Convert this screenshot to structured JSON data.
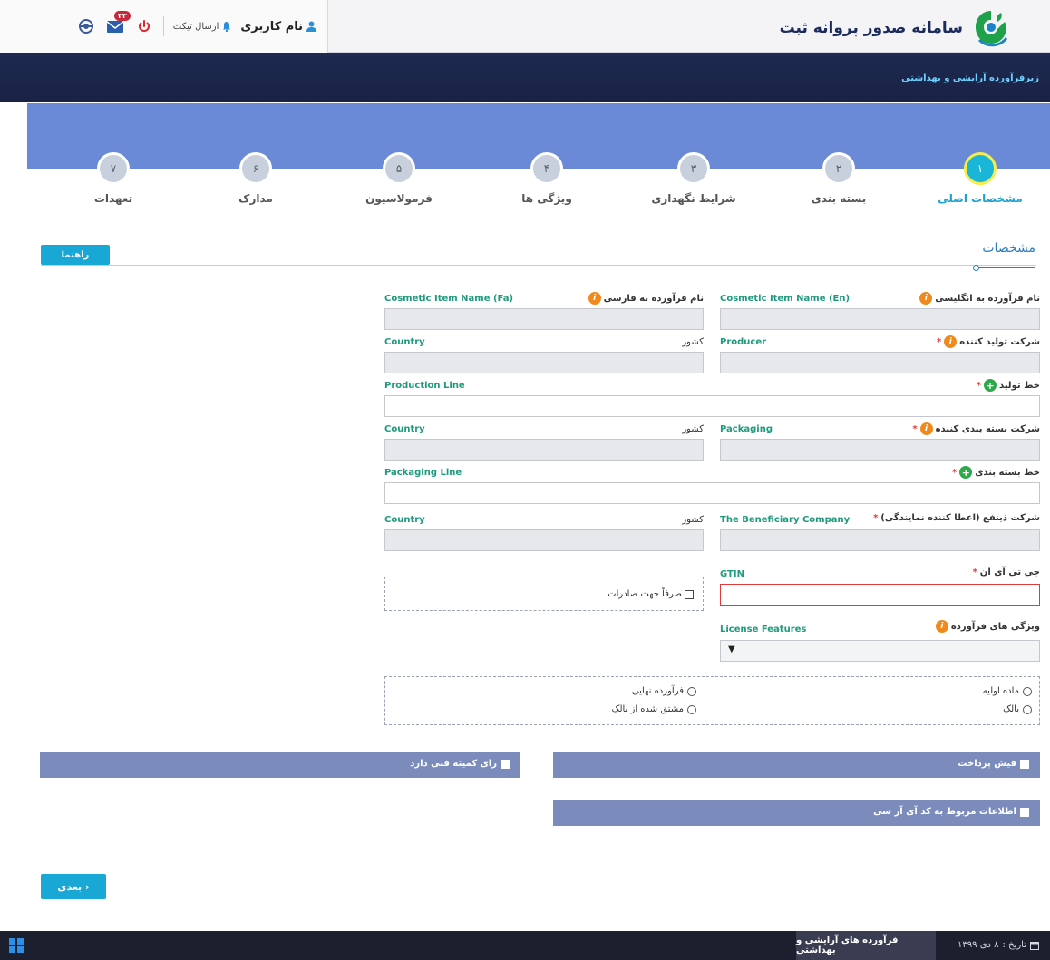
{
  "header": {
    "username": "نام کاربری",
    "send_ticket": "ارسال تیکت",
    "message_count": "۳۳",
    "brand_title": "سامانه صدور پروانه ثبت",
    "subtitle": "زیرفرآورده آرایشی و بهداشتی"
  },
  "steps": [
    {
      "num": "۱",
      "label": "مشخصات اصلی",
      "active": true
    },
    {
      "num": "۲",
      "label": "بسته بندی",
      "active": false
    },
    {
      "num": "۳",
      "label": "شرایط نگهداری",
      "active": false
    },
    {
      "num": "۴",
      "label": "ویژگی ها",
      "active": false
    },
    {
      "num": "۵",
      "label": "فرمولاسیون",
      "active": false
    },
    {
      "num": "۶",
      "label": "مدارک",
      "active": false
    },
    {
      "num": "۷",
      "label": "تعهدات",
      "active": false
    }
  ],
  "section": {
    "title": "مشخصات",
    "help_label": "راهنما"
  },
  "form": {
    "name_en_fa": "نام فرآورده به انگلیسی",
    "name_en_en": "Cosmetic Item Name (En)",
    "name_fa_fa": "نام فرآورده به فارسی",
    "name_fa_en": "Cosmetic Item Name (Fa)",
    "producer_fa": "شرکت تولید کننده",
    "producer_en": "Producer",
    "country_fa": "کشور",
    "country_en": "Country",
    "production_line_fa": "خط تولید",
    "production_line_en": "Production Line",
    "packaging_fa": "شرکت بسته بندی کننده",
    "packaging_en": "Packaging",
    "packaging_line_fa": "خط بسته بندی",
    "packaging_line_en": "Packaging Line",
    "beneficiary_fa": "شرکت ذینفع (اعطا کننده نمایندگی)",
    "beneficiary_en": "The Beneficiary Company",
    "gtin_fa": "جی تی آی ان",
    "gtin_en": "GTIN",
    "export_only": "صرفاً جهت صادرات",
    "features_fa": "ویژگی های فرآورده",
    "features_en": "License Features",
    "radio_raw": "ماده اولیه",
    "radio_final": "فرآورده نهایی",
    "radio_bulk": "بالک",
    "radio_derived": "مشتق شده از بالک"
  },
  "panels": {
    "payment": "فیش پرداخت",
    "technical": "رای کمیته فنی دارد",
    "irc": "اطلاعات مربوط به کد آی آر سی"
  },
  "buttons": {
    "next": "بعدی"
  },
  "footer": {
    "app_label": "فرآورده های آرایشی و بهداشتی",
    "date_label": "تاریخ :",
    "date_value": "۸ دی ۱۳۹۹"
  },
  "colors": {
    "accent": "#19a8d6",
    "band": "#6a8ad8",
    "dark": "#1e2a52",
    "panel": "#7b8cbc"
  }
}
